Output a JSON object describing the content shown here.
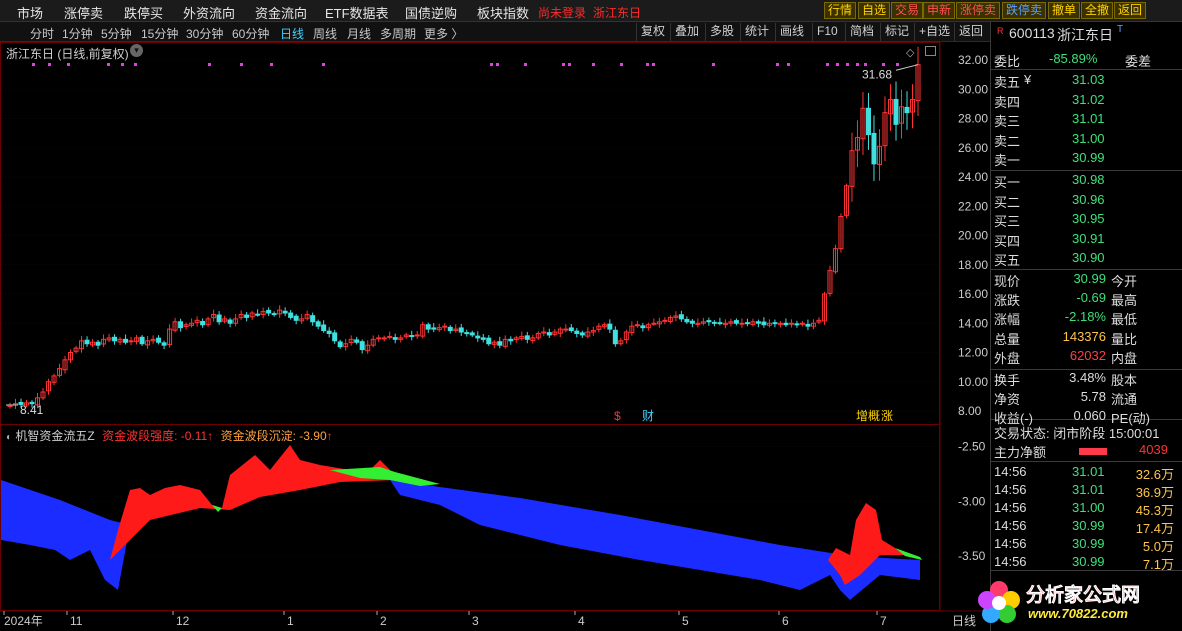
{
  "top_menu": {
    "items": [
      "市场",
      "涨停卖",
      "跌停买",
      "外资流向",
      "资金流向",
      "ETF数据表",
      "国债逆购",
      "板块指数"
    ],
    "login_status": "尚未登录",
    "stock_name_red": "浙江东日",
    "quick_buttons": [
      "行情",
      "自选",
      "交易",
      "申新",
      "涨停卖",
      "跌停卖",
      "撤单",
      "全撤",
      "返回"
    ]
  },
  "period_bar": {
    "periods": [
      "分时",
      "1分钟",
      "5分钟",
      "15分钟",
      "30分钟",
      "60分钟",
      "日线",
      "周线",
      "月线",
      "多周期",
      "更多 〉"
    ],
    "active": "日线",
    "tools": [
      "复权",
      "叠加",
      "多股",
      "统计",
      "画线",
      "F10",
      "简档",
      "标记",
      "+自选",
      "返回"
    ]
  },
  "main_chart": {
    "title": "浙江东日 (日线,前复权)",
    "y_ticks": [
      "32.00",
      "30.00",
      "28.00",
      "26.00",
      "24.00",
      "22.00",
      "20.00",
      "18.00",
      "16.00",
      "14.00",
      "12.00",
      "10.00",
      "8.00"
    ],
    "high_label": "31.68",
    "low_label": "8.41",
    "markers": [
      "$",
      "财",
      "增",
      "概",
      "涨"
    ]
  },
  "indicator": {
    "name": "机智资金流五Z",
    "strength_label": "资金波段强度:",
    "strength_value": "-0.11",
    "sink_label": "资金波段沉淀:",
    "sink_value": "-3.90",
    "arrow": "↑",
    "y_ticks": [
      "-2.50",
      "-3.00",
      "-3.50"
    ]
  },
  "x_axis": {
    "labels": [
      "2024年",
      "11",
      "12",
      "1",
      "2",
      "3",
      "4",
      "5",
      "6",
      "7"
    ],
    "right_label": "日线"
  },
  "quote": {
    "code_flag": "R",
    "code": "600113",
    "name": "浙江东日",
    "name_suffix": "T",
    "weibi_label": "委比",
    "weibi_value": "-85.89%",
    "weicha_label": "委差",
    "asks": [
      {
        "label": "卖五",
        "mark": "¥",
        "price": "31.03"
      },
      {
        "label": "卖四",
        "mark": "",
        "price": "31.02"
      },
      {
        "label": "卖三",
        "mark": "",
        "price": "31.01"
      },
      {
        "label": "卖二",
        "mark": "",
        "price": "31.00"
      },
      {
        "label": "卖一",
        "mark": "",
        "price": "30.99"
      }
    ],
    "bids": [
      {
        "label": "买一",
        "price": "30.98"
      },
      {
        "label": "买二",
        "price": "30.96"
      },
      {
        "label": "买三",
        "price": "30.95"
      },
      {
        "label": "买四",
        "price": "30.91"
      },
      {
        "label": "买五",
        "price": "30.90"
      }
    ],
    "stats": [
      {
        "l": "现价",
        "v": "30.99",
        "c": "#3ee07a",
        "r": "今开"
      },
      {
        "l": "涨跌",
        "v": "-0.69",
        "c": "#3ee07a",
        "r": "最高"
      },
      {
        "l": "涨幅",
        "v": "-2.18%",
        "c": "#3ee07a",
        "r": "最低"
      },
      {
        "l": "总量",
        "v": "143376",
        "c": "#ffc54a",
        "r": "量比"
      },
      {
        "l": "外盘",
        "v": "62032",
        "c": "#ff4040",
        "r": "内盘"
      }
    ],
    "stats2": [
      {
        "l": "换手",
        "v": "3.48%",
        "r": "股本"
      },
      {
        "l": "净资",
        "v": "5.78",
        "r": "流通"
      },
      {
        "l": "收益(-)",
        "v": "0.060",
        "r": "PE(动)"
      }
    ],
    "trade_status": "交易状态: 闭市阶段 15:00:01",
    "main_net_label": "主力净额",
    "main_net_value": "4039",
    "ticks": [
      {
        "t": "14:56",
        "p": "31.01",
        "v": "32.6万",
        "c": "#ffc54a"
      },
      {
        "t": "14:56",
        "p": "31.01",
        "v": "36.9万",
        "c": "#ffc54a"
      },
      {
        "t": "14:56",
        "p": "31.00",
        "v": "45.3万",
        "c": "#ffc54a"
      },
      {
        "t": "14:56",
        "p": "30.99",
        "v": "17.4万",
        "c": "#ffc54a"
      },
      {
        "t": "14:56",
        "p": "30.99",
        "v": "5.0万",
        "c": "#ffc54a"
      },
      {
        "t": "14:56",
        "p": "30.99",
        "v": "7.1万",
        "c": "#ffc54a"
      }
    ]
  },
  "watermark": {
    "title": "分析家公式网",
    "url": "www.70822.com"
  },
  "colors": {
    "up": "#ff3333",
    "down": "#3fe0e0",
    "fund_red": "#ff1a1a",
    "fund_blue": "#1a2cff",
    "fund_green": "#33ee33",
    "grid": "#3a0000"
  },
  "chart_data": {
    "type": "candlestick",
    "period": "daily",
    "series": [
      {
        "name": "close",
        "values": [
          8.41,
          8.5,
          8.45,
          8.55,
          8.5,
          8.9,
          9.3,
          10.0,
          10.4,
          10.9,
          11.5,
          12.0,
          12.3,
          12.8,
          12.6,
          12.7,
          12.5,
          12.9,
          13.0,
          12.8,
          12.9,
          12.7,
          12.8,
          13.0,
          12.6,
          12.8,
          12.9,
          12.7,
          12.5,
          13.6,
          14.1,
          13.7,
          13.9,
          14.0,
          14.2,
          13.9,
          14.3,
          14.6,
          14.1,
          14.3,
          14.0,
          14.3,
          14.6,
          14.4,
          14.7,
          14.6,
          14.8,
          14.7,
          14.6,
          14.9,
          14.7,
          14.4,
          14.2,
          14.3,
          14.6,
          14.1,
          13.8,
          13.5,
          13.3,
          12.8,
          12.4,
          12.6,
          12.9,
          12.7,
          12.2,
          12.5,
          12.9,
          13.0,
          13.0,
          13.1,
          12.9,
          13.0,
          13.2,
          13.1,
          13.2,
          13.9,
          13.6,
          13.6,
          13.7,
          13.8,
          13.5,
          13.6,
          13.4,
          13.3,
          13.2,
          13.0,
          12.9,
          12.6,
          12.7,
          12.5,
          12.9,
          12.8,
          13.0,
          13.1,
          12.9,
          13.0,
          13.3,
          13.4,
          13.2,
          13.4,
          13.6,
          13.6,
          13.5,
          13.3,
          13.2,
          13.4,
          13.5,
          13.8,
          13.9,
          13.6,
          12.6,
          12.8,
          13.4,
          13.8,
          13.9,
          13.7,
          13.9,
          14.0,
          14.1,
          14.2,
          14.4,
          14.5,
          14.3,
          14.1,
          14.0,
          14.0,
          14.1,
          14.1,
          14.0,
          14.0,
          14.0,
          14.1,
          14.0,
          14.0,
          14.0,
          14.1,
          14.0,
          13.9,
          14.0,
          14.0,
          14.0,
          13.9,
          14.0,
          13.9,
          14.0,
          13.8,
          14.0,
          14.2,
          16.0,
          17.6,
          19.1,
          21.3,
          23.4,
          25.8,
          26.7,
          28.7,
          26.9,
          24.9,
          26.1,
          28.4,
          29.3,
          27.6,
          28.8,
          28.4,
          29.3,
          31.68
        ]
      }
    ],
    "ylim": [
      8,
      32
    ],
    "indicator": {
      "name": "机智资金流五Z",
      "series": [
        {
          "name": "资金波段沉淀",
          "last": -3.9
        },
        {
          "name": "资金波段强度",
          "last": -0.11
        }
      ],
      "ylim": [
        -3.9,
        -2.35
      ]
    }
  }
}
